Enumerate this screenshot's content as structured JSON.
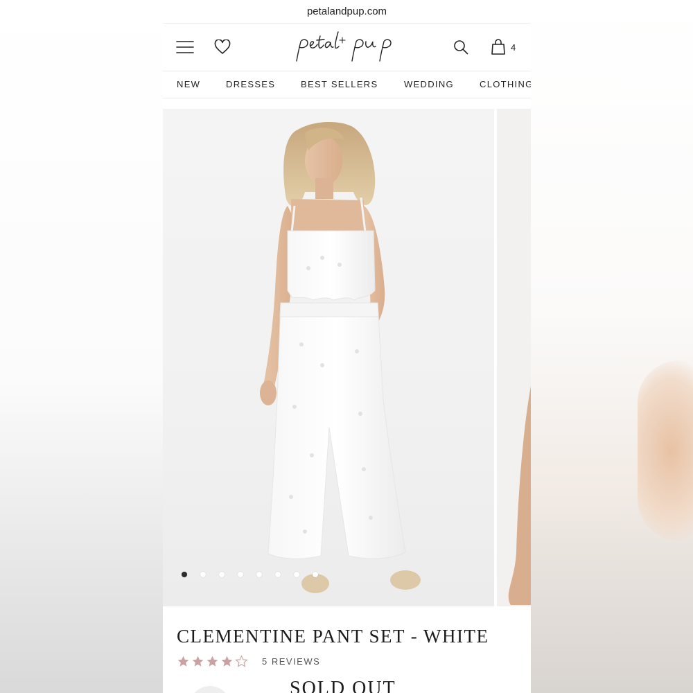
{
  "browser": {
    "url": "petalandpup.com"
  },
  "header": {
    "logo_text": "petal + pup",
    "cart_count": "4"
  },
  "nav": {
    "items": [
      "NEW",
      "DRESSES",
      "BEST SELLERS",
      "WEDDING",
      "CLOTHING"
    ]
  },
  "gallery": {
    "image_count": 8,
    "active_index": 0
  },
  "product": {
    "title": "CLEMENTINE PANT SET - WHITE",
    "rating": 4,
    "rating_max": 5,
    "reviews_label": "5 REVIEWS",
    "status": "SOLD OUT"
  },
  "colors": {
    "star_fill": "#c9a3a3",
    "text": "#1c1c1c",
    "dot_active": "#2b2b2b"
  }
}
